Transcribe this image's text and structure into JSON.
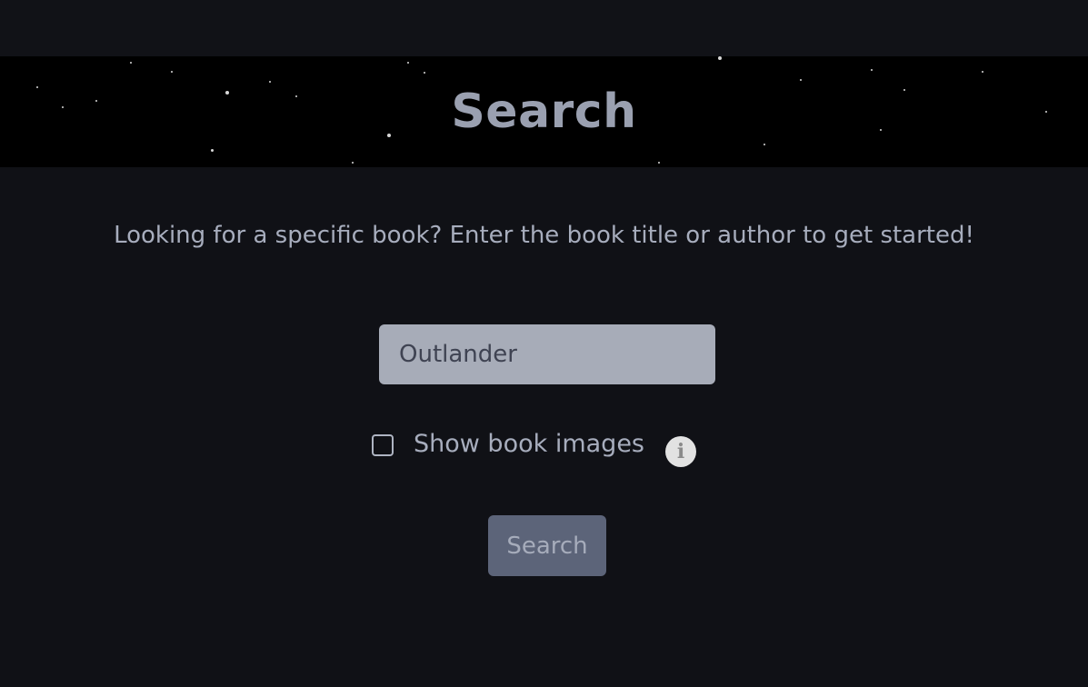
{
  "banner": {
    "title": "Search"
  },
  "intro": {
    "text": "Looking for a specific book? Enter the book title or author to get started!"
  },
  "search": {
    "value": "Outlander"
  },
  "options": {
    "show_images_label": "Show book images",
    "show_images_checked": false,
    "info_icon": "info-circle-icon"
  },
  "actions": {
    "search_label": "Search"
  },
  "colors": {
    "page_background": "#101116",
    "banner_background": "#000000",
    "banner_title": "#9aa0b0",
    "text": "#a7adbd",
    "input_background": "#a7acb8",
    "button_background": "#5c6479"
  }
}
